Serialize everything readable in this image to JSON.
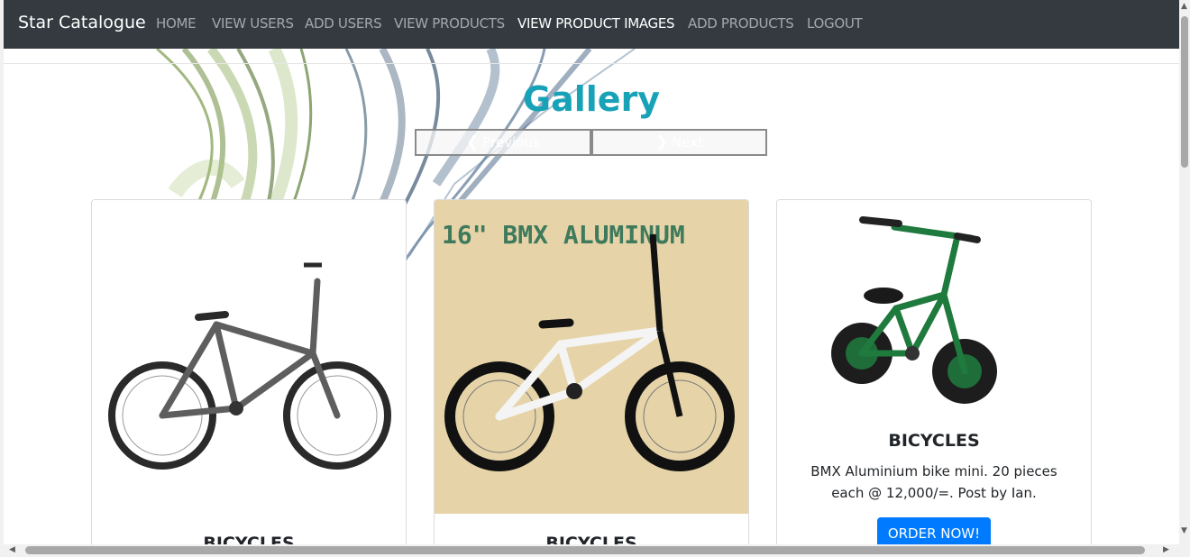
{
  "navbar": {
    "brand": "Star Catalogue",
    "links": [
      {
        "label": "HOME"
      },
      {
        "label": "VIEW USERS"
      },
      {
        "label": "ADD USERS"
      },
      {
        "label": "VIEW PRODUCTS"
      },
      {
        "label": "VIEW PRODUCT IMAGES",
        "active": true
      },
      {
        "label": "ADD PRODUCTS"
      },
      {
        "label": "LOGOUT"
      }
    ]
  },
  "gallery": {
    "title": "Gallery",
    "prev_label": "Previous",
    "next_label": "Next"
  },
  "cards": [
    {
      "title": "BICYCLES",
      "image_text": ""
    },
    {
      "title": "BICYCLES",
      "image_text": "16\" BMX ALUMINUM"
    },
    {
      "title": "BICYCLES",
      "description": "BMX Aluminium bike mini. 20 pieces each @ 12,000/=. Post by Ian.",
      "button_label": "ORDER NOW!"
    }
  ],
  "colors": {
    "navbar_bg": "#343a40",
    "title": "#17a2b8",
    "button": "#007bff"
  }
}
